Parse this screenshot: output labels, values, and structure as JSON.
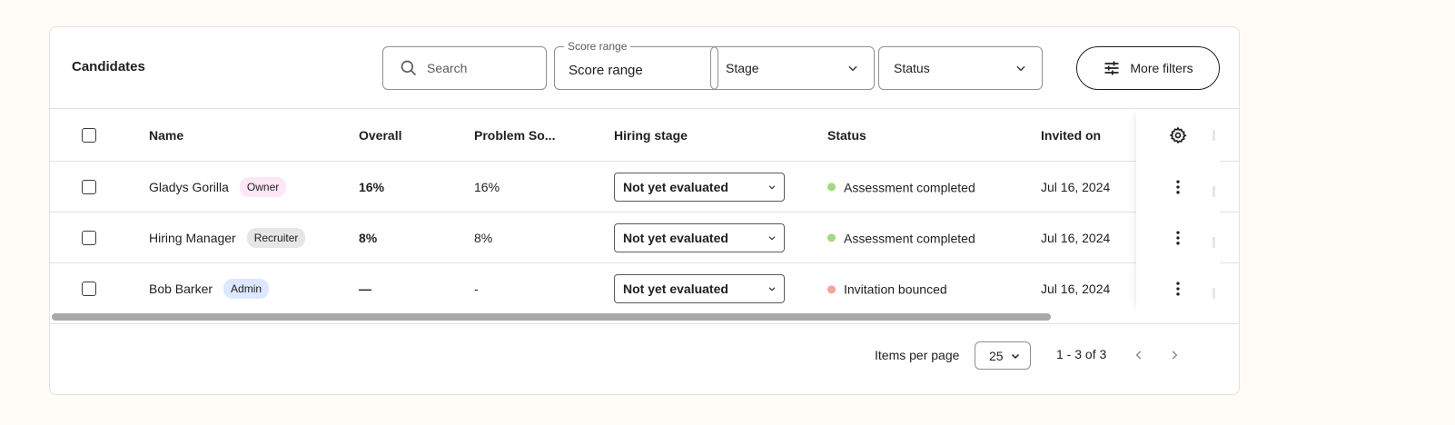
{
  "header": {
    "title": "Candidates",
    "search_placeholder": "Search",
    "score_range_label": "Score range",
    "score_range_value": "Score range",
    "stage_label": "Stage",
    "status_label": "Status",
    "more_filters_label": "More filters"
  },
  "table": {
    "columns": [
      "Name",
      "Overall",
      "Problem So...",
      "Hiring stage",
      "Status",
      "Invited on"
    ],
    "rows": [
      {
        "name": "Gladys Gorilla",
        "role": "Owner",
        "overall": "16%",
        "problem_solving": "16%",
        "hiring_stage": "Not yet evaluated",
        "status": "Assessment completed",
        "invited_on": "Jul 16, 2024"
      },
      {
        "name": "Hiring Manager",
        "role": "Recruiter",
        "overall": "8%",
        "problem_solving": "8%",
        "hiring_stage": "Not yet evaluated",
        "status": "Assessment completed",
        "invited_on": "Jul 16, 2024"
      },
      {
        "name": "Bob Barker",
        "role": "Admin",
        "overall": "—",
        "problem_solving": "-",
        "hiring_stage": "Not yet evaluated",
        "status": "Invitation bounced",
        "invited_on": "Jul 16, 2024"
      }
    ]
  },
  "colors": {
    "owner_badge_bg": "#fde6f6",
    "recruiter_badge_bg": "#e6e6e6",
    "admin_badge_bg": "#dbe8ff",
    "status_completed": "#9fdc7a",
    "status_bounced": "#f4a595"
  },
  "icons": {
    "search": "search-icon",
    "chevron": "chevron-down-icon",
    "filters": "sliders-icon",
    "settings": "gear-icon",
    "row_menu": "more-vertical-icon",
    "prev": "chevron-left-icon",
    "next": "chevron-right-icon"
  },
  "footer": {
    "items_per_page_label": "Items per page",
    "items_per_page_value": "25",
    "range_text": "1 - 3 of 3"
  }
}
